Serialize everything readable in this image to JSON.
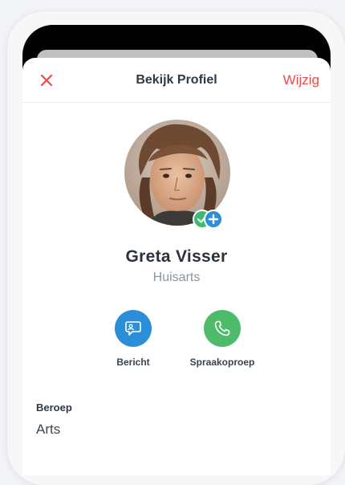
{
  "navbar": {
    "close_icon": "close-x-icon",
    "title": "Bekijk Profiel",
    "edit_label": "Wijzig",
    "accent_color": "#ef4a4a"
  },
  "profile": {
    "name": "Greta Visser",
    "role": "Huisarts",
    "status_badges": [
      "check-icon",
      "plus-icon"
    ]
  },
  "actions": [
    {
      "label": "Bericht",
      "icon": "message-bubble-icon",
      "color": "#2c8ed8"
    },
    {
      "label": "Spraakoproep",
      "icon": "phone-icon",
      "color": "#4ebb6b"
    }
  ],
  "details": {
    "occupation_label": "Beroep",
    "occupation_value": "Arts"
  }
}
